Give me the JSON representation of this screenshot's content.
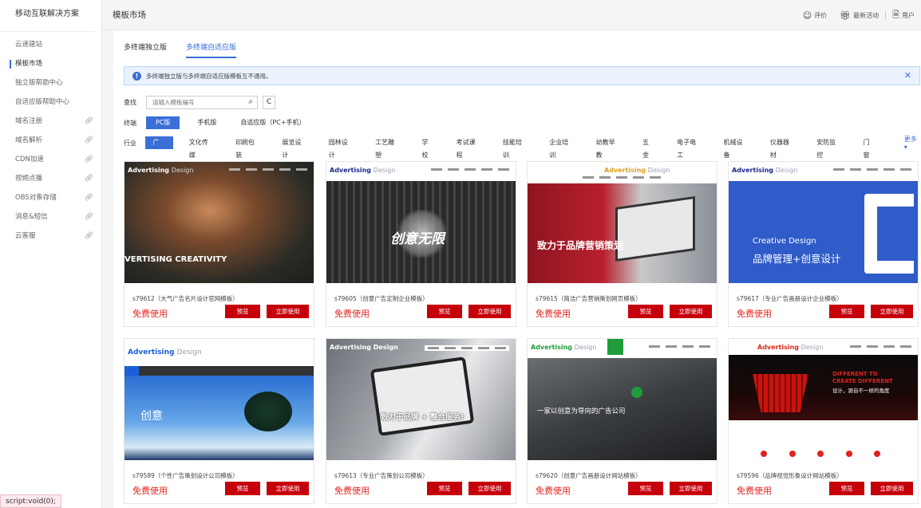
{
  "sidebar": {
    "title": "移动互联解决方案",
    "items": [
      {
        "label": "云速建站",
        "link": false,
        "active": false
      },
      {
        "label": "模板市场",
        "link": false,
        "active": true
      },
      {
        "label": "独立版帮助中心",
        "link": false,
        "active": false
      },
      {
        "label": "自适应版帮助中心",
        "link": false,
        "active": false
      },
      {
        "label": "域名注册",
        "link": true,
        "active": false
      },
      {
        "label": "域名解析",
        "link": true,
        "active": false
      },
      {
        "label": "CDN加速",
        "link": true,
        "active": false
      },
      {
        "label": "视频点播",
        "link": true,
        "active": false
      },
      {
        "label": "OBS对象存储",
        "link": true,
        "active": false
      },
      {
        "label": "消息&短信",
        "link": true,
        "active": false
      },
      {
        "label": "云客服",
        "link": true,
        "active": false
      }
    ]
  },
  "status_bar": "script:void(0);",
  "header": {
    "title": "模板市场",
    "review": "评价",
    "activity": "最新活动",
    "user": "用户"
  },
  "tabs": [
    "多终端独立版",
    "多终端自适应版"
  ],
  "notice": "多终端独立版与多终端自适应版模板互不通用。",
  "search": {
    "label": "查找",
    "placeholder": "请输入模板编号"
  },
  "terminal": {
    "label": "终端",
    "options": [
      "PC版",
      "手机版",
      "自适应版（PC+手机）"
    ]
  },
  "industry": {
    "label": "行业",
    "options": [
      "广告",
      "文化传媒",
      "印刷包装",
      "展览设计",
      "园林设计",
      "工艺雕塑",
      "学校",
      "考试课程",
      "技能培训",
      "企业培训",
      "幼教早教",
      "五金",
      "电子电工",
      "机械设备",
      "仪器器材",
      "安防监控",
      "门窗"
    ],
    "more": "更多"
  },
  "free_label": "免费使用",
  "preview_label": "预览",
  "use_label": "立即使用",
  "templates": [
    {
      "name": "s79612（大气广告名片设计官网模板）",
      "brand": "Advertising",
      "brand2": "Design",
      "hero": "VERTISING CREATIVITY"
    },
    {
      "name": "s79605（创意广告定制企业模板）",
      "brand": "Advertising",
      "brand2": "Design",
      "hero": "创意无限"
    },
    {
      "name": "s79615（简洁广告营销策划网页模板）",
      "brand": "Advertising",
      "brand2": "Design",
      "hero": "致力于品牌营销策划"
    },
    {
      "name": "s79617（专业广告画册设计企业模板）",
      "brand": "Advertising",
      "brand2": "Design",
      "hero": "Creative Design",
      "hero2": "品牌管理+创意设计"
    },
    {
      "name": "s79589（个性广告策划设计公司模板）",
      "brand": "Advertising",
      "brand2": "Design",
      "hero": "创意"
    },
    {
      "name": "s79613（专业广告策划公司模板）",
      "brand": "Advertising Design",
      "brand2": "",
      "hero": "致力于品牌 + 整合服务!"
    },
    {
      "name": "s79620（创意广告画册设计网站模板）",
      "brand": "Advertising",
      "brand2": "Design",
      "hero": "一家以创意为导向的广告公司"
    },
    {
      "name": "s79596（品牌视觉形象设计网站模板）",
      "brand": "Advertising",
      "brand2": "Design",
      "hero": "DIFFERENT TO",
      "hero2": "CREATE DIFFERENT",
      "hero3": "设计，源自不一样的角度"
    }
  ]
}
